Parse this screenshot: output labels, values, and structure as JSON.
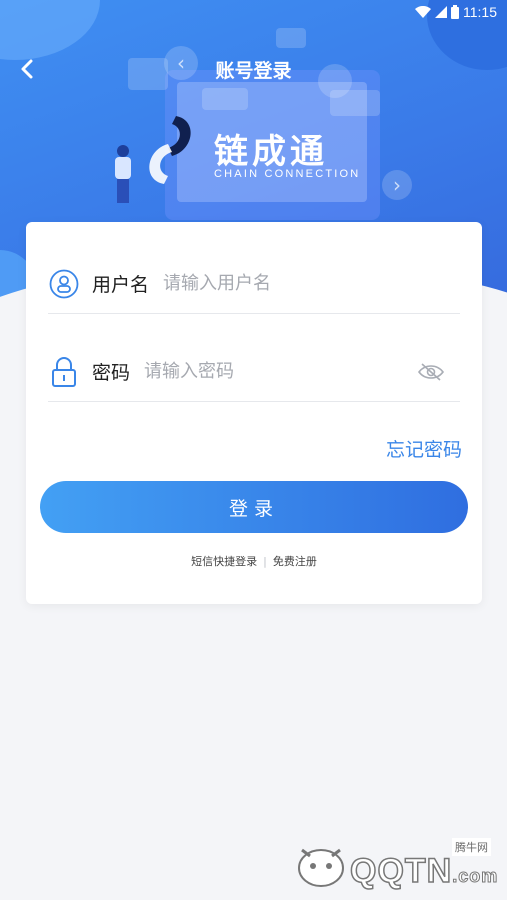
{
  "status_bar": {
    "time": "11:15"
  },
  "nav": {
    "title": "账号登录"
  },
  "logo": {
    "name": "链成通",
    "subtitle": "CHAIN CONNECTION"
  },
  "form": {
    "username": {
      "label": "用户名",
      "placeholder": "请输入用户名",
      "value": ""
    },
    "password": {
      "label": "密码",
      "placeholder": "请输入密码",
      "value": ""
    },
    "forgot_label": "忘记密码",
    "login_label": "登录",
    "sms_login_label": "短信快捷登录",
    "separator": "|",
    "register_label": "免费注册"
  },
  "watermark": {
    "badge": "腾牛网",
    "brand": "QQTN",
    "suffix": ".com"
  },
  "colors": {
    "primary": "#3a86e8",
    "hero_top": "#3f8ff2",
    "hero_bottom": "#3568dc"
  },
  "icons": [
    "back-arrow-icon",
    "user-icon",
    "lock-icon",
    "eye-closed-icon",
    "wifi-icon",
    "signal-icon",
    "battery-icon"
  ]
}
